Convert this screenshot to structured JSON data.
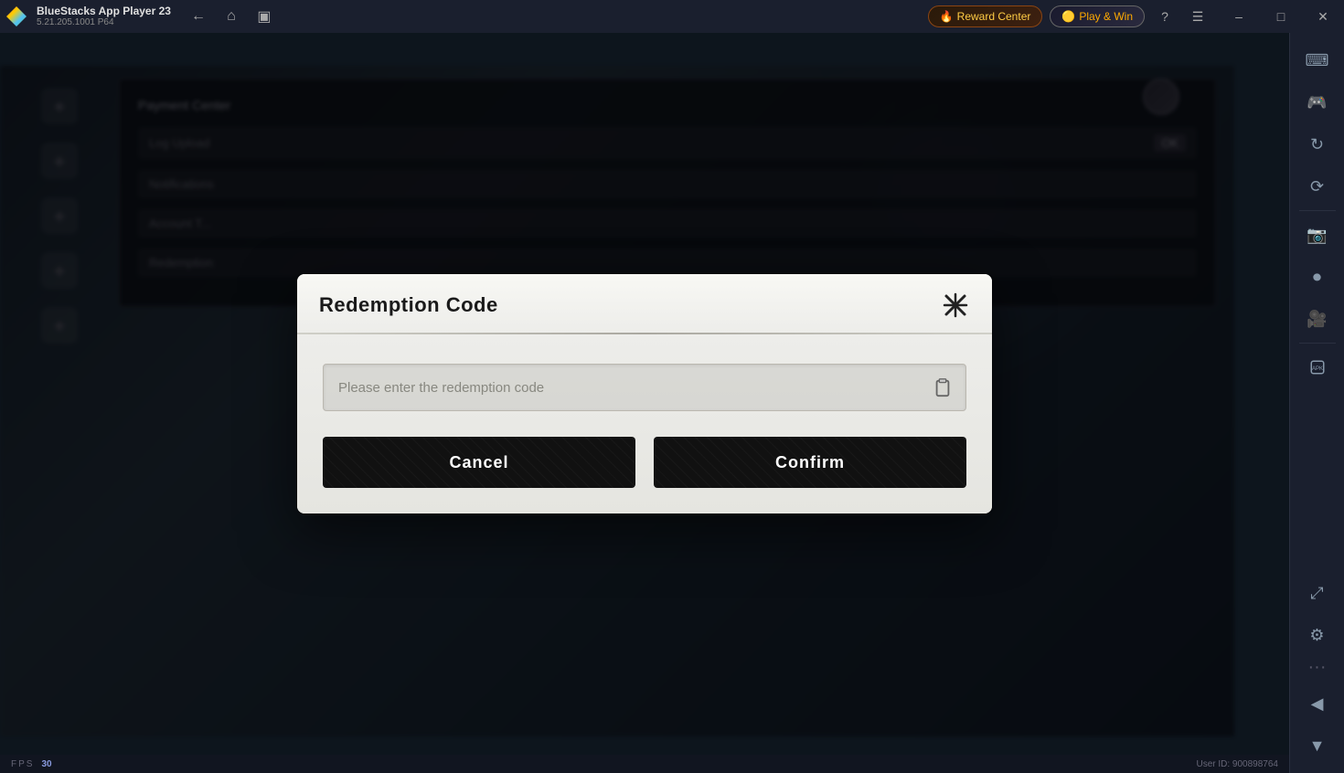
{
  "titlebar": {
    "app_name": "BlueStacks App Player 23",
    "app_version": "5.21.205.1001 P64",
    "reward_center_label": "Reward Center",
    "play_win_label": "Play & Win"
  },
  "statusbar": {
    "fps_label": "FPS",
    "fps_value": "30",
    "user_id_label": "User ID: 900898764"
  },
  "dialog": {
    "title": "Redemption Code",
    "input_placeholder": "Please enter the redemption code",
    "cancel_label": "Cancel",
    "confirm_label": "Confirm"
  },
  "sidebar": {
    "icons": [
      "arrow-left-icon",
      "keyboard-icon",
      "refresh-icon",
      "rotate-icon",
      "screenshot-icon",
      "record-icon",
      "camera-icon",
      "apk-icon",
      "settings-icon",
      "arrow-collapse-icon"
    ]
  }
}
